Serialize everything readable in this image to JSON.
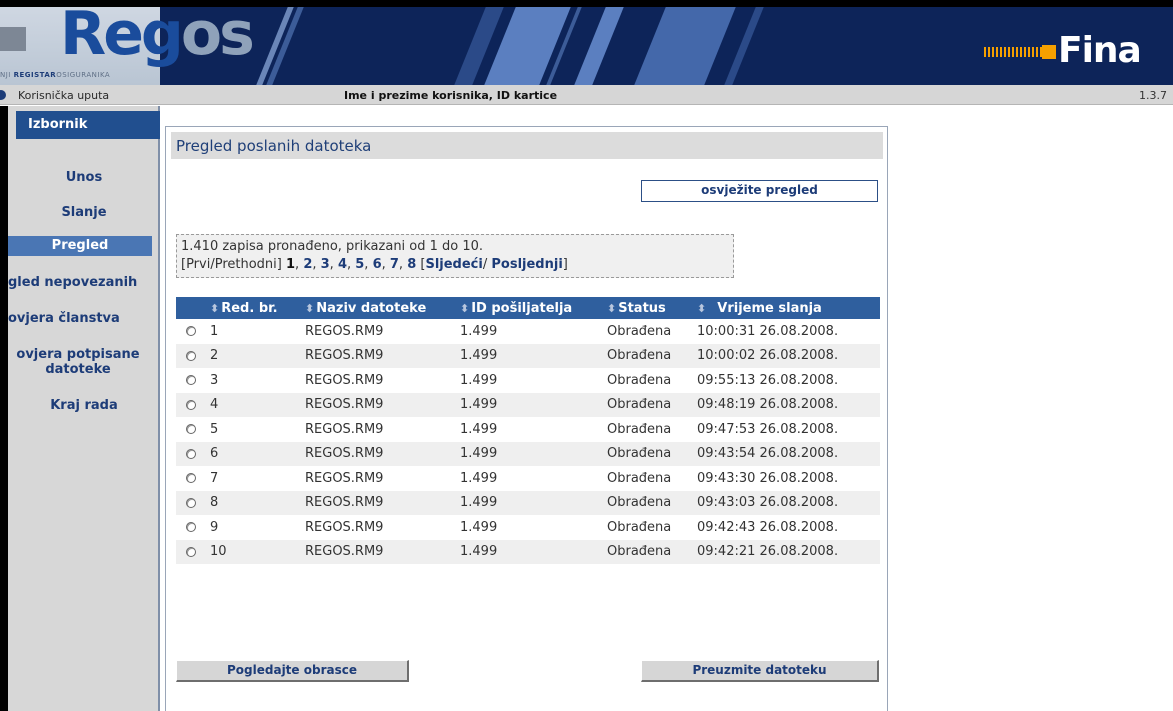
{
  "header": {
    "logo_main": "Reg",
    "logo_os": "os",
    "logo_sub_prefix": "NJI ",
    "logo_sub_bold": "REGISTAR",
    "logo_sub_rest": "OSIGURANIKA",
    "fina_text": "Fina",
    "colors": {
      "banner": "#0d2459",
      "accent_orange": "#f5a000",
      "logo_blue": "#1a4c9c"
    }
  },
  "infobar": {
    "help_label": "Korisnička uputa",
    "user_label": "Ime i prezime korisnika, ID kartice",
    "version": "1.3.7"
  },
  "sidebar": {
    "title": "Izbornik",
    "items": [
      {
        "label": "Unos"
      },
      {
        "label": "Slanje"
      },
      {
        "label": "Pregled"
      },
      {
        "label": "gled nepovezanih"
      },
      {
        "label": "ovjera članstva"
      },
      {
        "label": "ovjera potpisane datoteke"
      },
      {
        "label": "Kraj rada"
      }
    ],
    "active_index": 2
  },
  "main": {
    "title": "Pregled poslanih datoteka",
    "refresh_button": "osvježite pregled",
    "records_info": "1.410 zapisa pronađeno, prikazani od 1 do 10.",
    "pager": {
      "first_prev": "[Prvi/Prethodni]",
      "pages": [
        "1",
        "2",
        "3",
        "4",
        "5",
        "6",
        "7",
        "8"
      ],
      "current_page": "1",
      "next_last_open": "[",
      "next": "Sljedeći",
      "sep": "/",
      "last": "Posljednji",
      "close": "]"
    },
    "table": {
      "columns": [
        "Red. br.",
        "Naziv datoteke",
        "ID pošiljatelja",
        "Status",
        "Vrijeme slanja"
      ],
      "rows": [
        [
          "1",
          "REGOS.RM9",
          "1.499",
          "Obrađena",
          "10:00:31 26.08.2008."
        ],
        [
          "2",
          "REGOS.RM9",
          "1.499",
          "Obrađena",
          "10:00:02 26.08.2008."
        ],
        [
          "3",
          "REGOS.RM9",
          "1.499",
          "Obrađena",
          "09:55:13 26.08.2008."
        ],
        [
          "4",
          "REGOS.RM9",
          "1.499",
          "Obrađena",
          "09:48:19 26.08.2008."
        ],
        [
          "5",
          "REGOS.RM9",
          "1.499",
          "Obrađena",
          "09:47:53 26.08.2008."
        ],
        [
          "6",
          "REGOS.RM9",
          "1.499",
          "Obrađena",
          "09:43:54 26.08.2008."
        ],
        [
          "7",
          "REGOS.RM9",
          "1.499",
          "Obrađena",
          "09:43:30 26.08.2008."
        ],
        [
          "8",
          "REGOS.RM9",
          "1.499",
          "Obrađena",
          "09:43:03 26.08.2008."
        ],
        [
          "9",
          "REGOS.RM9",
          "1.499",
          "Obrađena",
          "09:42:43 26.08.2008."
        ],
        [
          "10",
          "REGOS.RM9",
          "1.499",
          "Obrađena",
          "09:42:21 26.08.2008."
        ]
      ]
    },
    "view_forms_button": "Pogledajte obrasce",
    "download_button": "Preuzmite datoteku"
  }
}
